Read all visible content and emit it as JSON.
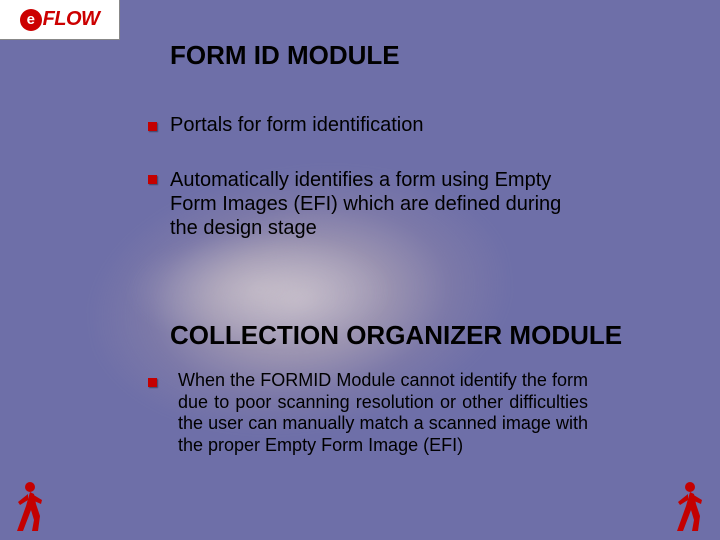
{
  "logo": {
    "text": "FLOW",
    "badge": "e"
  },
  "heading1": "FORM ID MODULE",
  "bullets_section1": [
    "Portals for  form identification",
    "Automatically identifies a form using Empty Form Images (EFI) which are defined during the design stage"
  ],
  "heading2": "COLLECTION ORGANIZER MODULE",
  "bullets_section2": [
    "When the FORMID Module cannot identify the form due to poor scanning resolution or other difficulties the user can manually match a scanned image with the proper Empty Form Image (EFI)"
  ],
  "icons": {
    "walker_color": "#c40000"
  }
}
